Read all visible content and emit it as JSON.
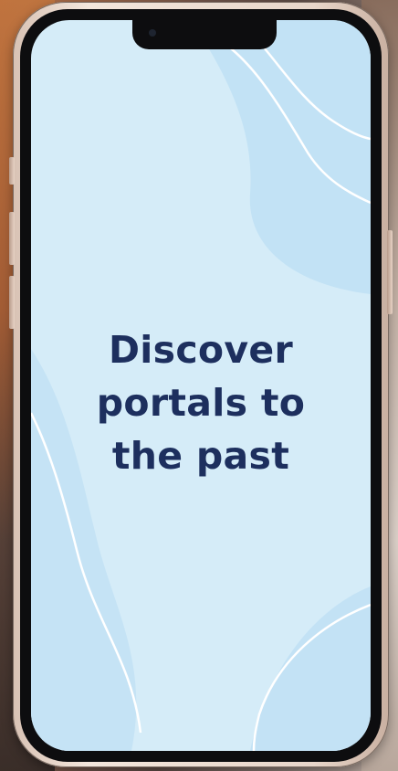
{
  "screen": {
    "headline_lines": [
      "Discover",
      "portals to",
      "the past"
    ]
  },
  "colors": {
    "screen_background": "#d5ecf8",
    "headline_text": "#1d2f5e",
    "wave_shape": "#c2e2f5",
    "wave_line": "#ffffff",
    "phone_frame": "#e8d6ca"
  },
  "icons": {
    "camera": "front-camera-icon"
  }
}
